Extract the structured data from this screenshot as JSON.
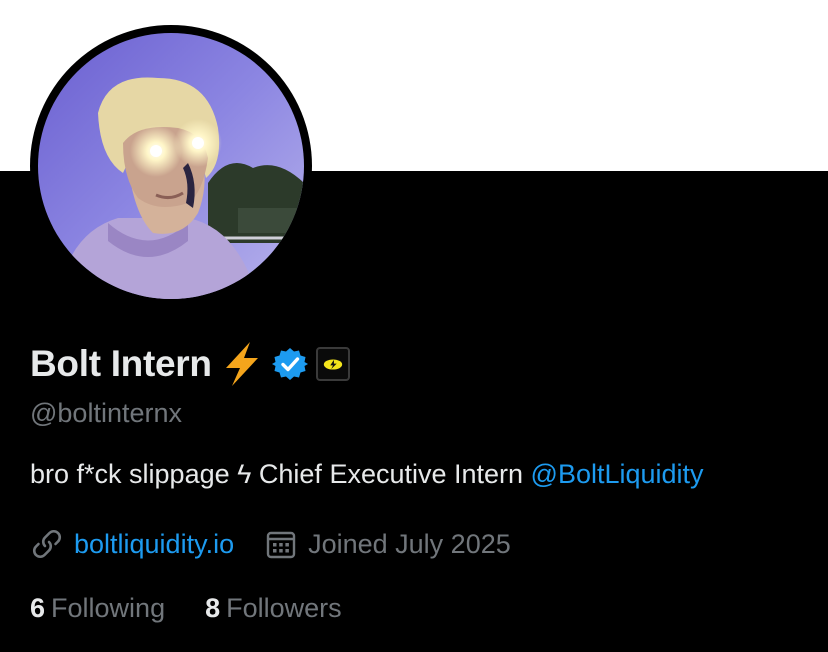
{
  "profile": {
    "display_name": "Bolt Intern",
    "name_emoji": "lightning-bolt-emoji",
    "handle": "@boltinternx",
    "bio_text": "bro f*ck slippage ϟ Chief Executive Intern ",
    "bio_mention": "@BoltLiquidity",
    "website": "boltliquidity.io",
    "joined": "Joined July 2025",
    "following_count": "6",
    "following_label": "Following",
    "followers_count": "8",
    "followers_label": "Followers"
  },
  "icons": {
    "verified": "verified-badge-icon",
    "affiliate": "affiliate-badge-icon",
    "link": "link-icon",
    "calendar": "calendar-icon"
  },
  "colors": {
    "background": "#000000",
    "banner": "#ffffff",
    "primary_text": "#e7e9ea",
    "secondary_text": "#71767b",
    "link": "#1d9bf0",
    "verified": "#1d9bf0",
    "bolt_emoji": "#f4a51c"
  }
}
